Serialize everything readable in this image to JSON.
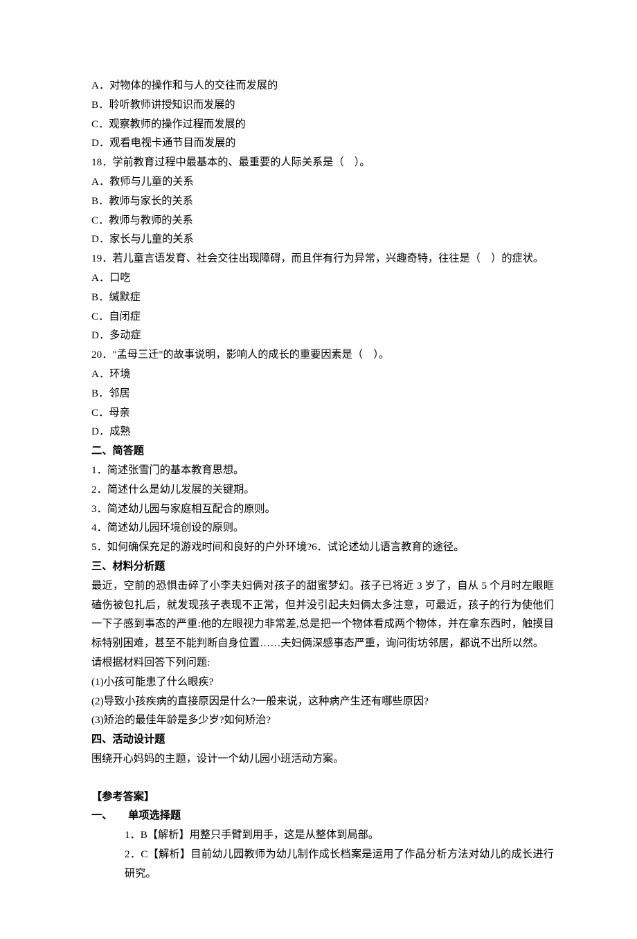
{
  "q17": {
    "optA": "A．对物体的操作和与人的交往而发展的",
    "optB": "B．聆听教师讲授知识而发展的",
    "optC": "C．观察教师的操作过程而发展的",
    "optD": "D．观看电视卡通节目而发展的"
  },
  "q18": {
    "stem": "18．学前教育过程中最基本的、最重要的人际关系是（　）。",
    "optA": "A．教师与儿童的关系",
    "optB": "B．教师与家长的关系",
    "optC": "C．教师与教师的关系",
    "optD": "D．家长与儿童的关系"
  },
  "q19": {
    "stem": "19．若儿童言语发育、社会交往出现障碍，而且伴有行为异常，兴趣奇特，往往是（　）的症状。",
    "optA": "A．口吃",
    "optB": "B．缄默症",
    "optC": "C．自闭症",
    "optD": "D．多动症"
  },
  "q20": {
    "stem": "20．\"孟母三迁\"的故事说明，影响人的成长的重要因素是（　）。",
    "optA": "A．环境",
    "optB": "B．邻居",
    "optC": "C．母亲",
    "optD": "D．成熟"
  },
  "sections": {
    "s2": "二、简答题",
    "s3": "三、材料分析题",
    "s4": "四、活动设计题"
  },
  "short_answers": {
    "1": "1．简述张雪门的基本教育思想。",
    "2": "2．简述什么是幼儿发展的关键期。",
    "3": "3．简述幼儿园与家庭相互配合的原则。",
    "4": "4．简述幼儿园环境创设的原则。",
    "5": "5．如何确保充足的游戏时间和良好的户外环境?6．试论述幼儿语言教育的途径。"
  },
  "material": {
    "p1": "最近，空前的恐惧击碎了小李夫妇俩对孩子的甜蜜梦幻。孩子已将近 3 岁了，自从 5 个月时左眼眶磕伤被包扎后，就发现孩子表现不正常，但并没引起夫妇俩太多注意，可最近，孩子的行为使他们一下子感到事态的严重:他的左眼视力非常差,总是把一个物体看成两个物体，并在拿东西时，触摸目标特别困难，甚至不能判断自身位置……夫妇俩深感事态严重，询问街坊邻居，都说不出所以然。",
    "p2": "请根据材料回答下列问题:",
    "q1": "(1)小孩可能患了什么眼疾?",
    "q2": "(2)导致小孩疾病的直接原因是什么?一般来说，这种病产生还有哪些原因?",
    "q3": "(3)矫治的最佳年龄是多少岁?如何矫治?"
  },
  "activity": {
    "text": "围绕开心妈妈的主题，设计一个幼儿园小班活动方案。"
  },
  "answers": {
    "heading": "【参考答案】",
    "section1": "一、　　单项选择题",
    "a1": "1．B【解析】用整只手臂到用手，这是从整体到局部。",
    "a2": "2．C【解析】目前幼儿园教师为幼儿制作成长档案是运用了作品分析方法对幼儿的成长进行研究。"
  }
}
